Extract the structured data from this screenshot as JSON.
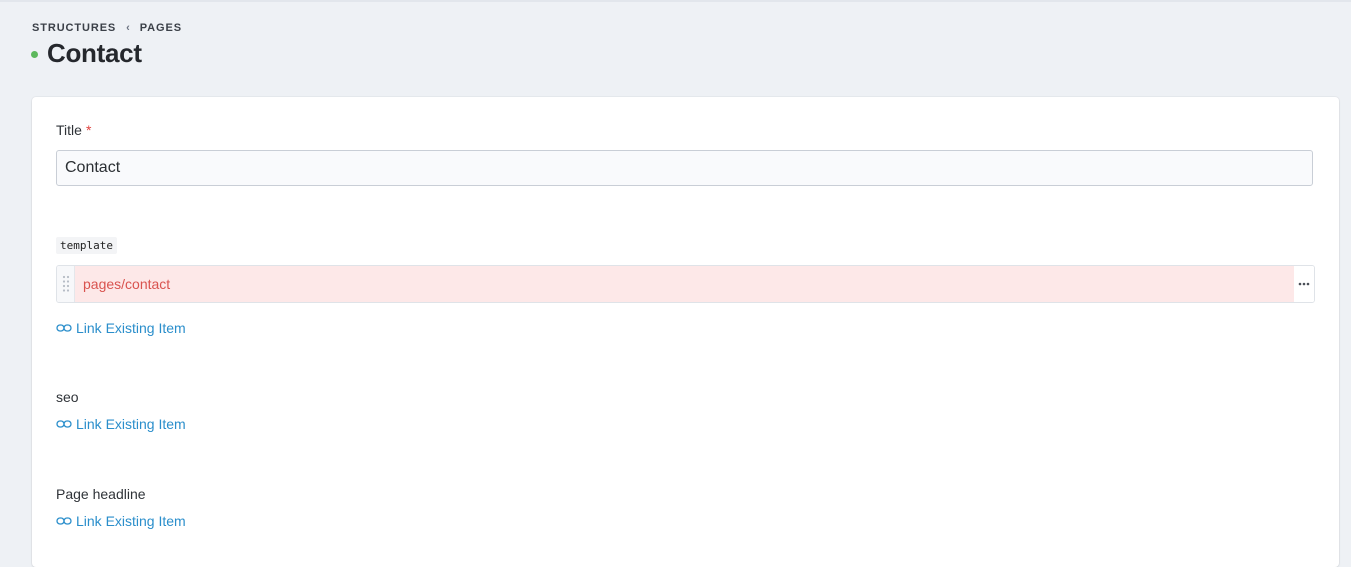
{
  "breadcrumb": {
    "parent": "STRUCTURES",
    "separator": "‹",
    "current": "PAGES"
  },
  "page": {
    "title": "Contact",
    "status_color": "#5cb85c"
  },
  "fields": {
    "title": {
      "label": "Title",
      "required_mark": "*",
      "value": "Contact"
    },
    "template": {
      "label": "template",
      "item_value": "pages/contact",
      "more_icon": "ellipsis-icon",
      "drag_icon": "drag-handle-icon",
      "link_label": "Link Existing Item"
    },
    "seo": {
      "label": "seo",
      "link_label": "Link Existing Item"
    },
    "page_headline": {
      "label": "Page headline",
      "link_label": "Link Existing Item"
    }
  },
  "colors": {
    "link": "#2a8ecb",
    "error_bg": "#fde8e8",
    "error_text": "#d9534f",
    "required": "#e0433f"
  }
}
